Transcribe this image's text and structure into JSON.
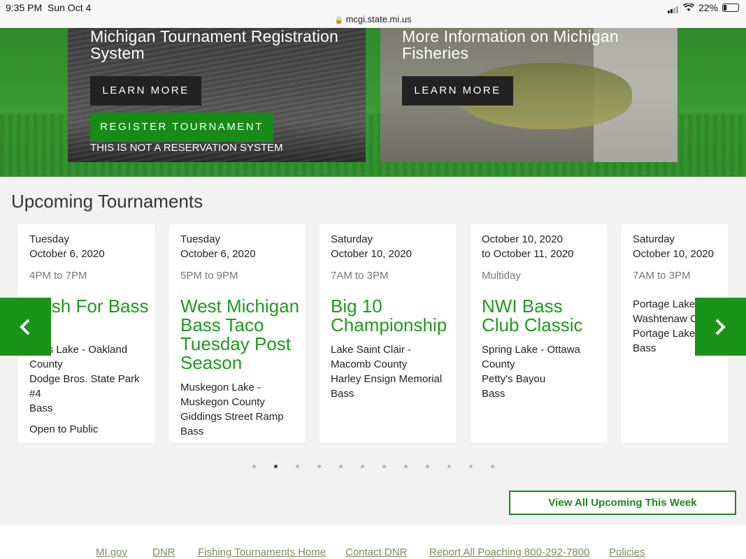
{
  "status_bar": {
    "time": "9:35 PM",
    "date": "Sun Oct 4",
    "url": "mcgi.state.mi.us",
    "battery": "22%"
  },
  "hero": {
    "left": {
      "title_line1": "Michigan Tournament Registration",
      "title_line2": "System",
      "learn_more": "LEARN MORE",
      "register": "REGISTER TOURNAMENT",
      "note": "THIS IS NOT A RESERVATION SYSTEM"
    },
    "right": {
      "title_line1": "More Information on Michigan",
      "title_line2": "Fisheries",
      "learn_more": "LEARN MORE"
    }
  },
  "upcoming": {
    "title": "Upcoming Tournaments",
    "cards": [
      {
        "date1": "Tuesday",
        "date2": "October 6, 2020",
        "time": "4PM to 7PM",
        "name": "Bash For Bass",
        "lines": [
          "Cass Lake - Oakland County",
          "Dodge Bros. State Park #4",
          "Bass"
        ],
        "extra": "Open to Public"
      },
      {
        "date1": "Tuesday",
        "date2": "October 6, 2020",
        "time": "5PM to 9PM",
        "name": "West Michigan Bass Taco Tuesday Post Season",
        "lines": [
          "Muskegon Lake - Muskegon County",
          "Giddings Street Ramp",
          "Bass"
        ]
      },
      {
        "date1": "Saturday",
        "date2": "October 10, 2020",
        "time": "7AM to 3PM",
        "name": "Big 10 Championship",
        "lines": [
          "Lake Saint Clair - Macomb County",
          "Harley Ensign Memorial",
          "Bass"
        ]
      },
      {
        "date1": "October 10, 2020",
        "date2": "to October 11, 2020",
        "time": "Multiday",
        "name": "NWI Bass Club Classic",
        "lines": [
          "Spring Lake - Ottawa County",
          "Petty's Bayou",
          "Bass"
        ]
      },
      {
        "date1": "Saturday",
        "date2": "October 10, 2020",
        "time": "7AM to 3PM",
        "name": "",
        "lines": [
          "Portage Lake - Washtenaw County",
          "Portage Lake",
          "Bass"
        ]
      }
    ],
    "dots_count": 12,
    "active_dot": 1,
    "view_all": "View All Upcoming This Week"
  },
  "footer": {
    "links": [
      "MI.gov",
      "DNR",
      "Fishing Tournaments Home",
      "Contact DNR",
      "Report All Poaching 800-292-7800",
      "Policies"
    ]
  },
  "colors": {
    "brand_green": "#199419",
    "title_green": "#1e9a1e",
    "link_green": "#7a8f5a"
  }
}
